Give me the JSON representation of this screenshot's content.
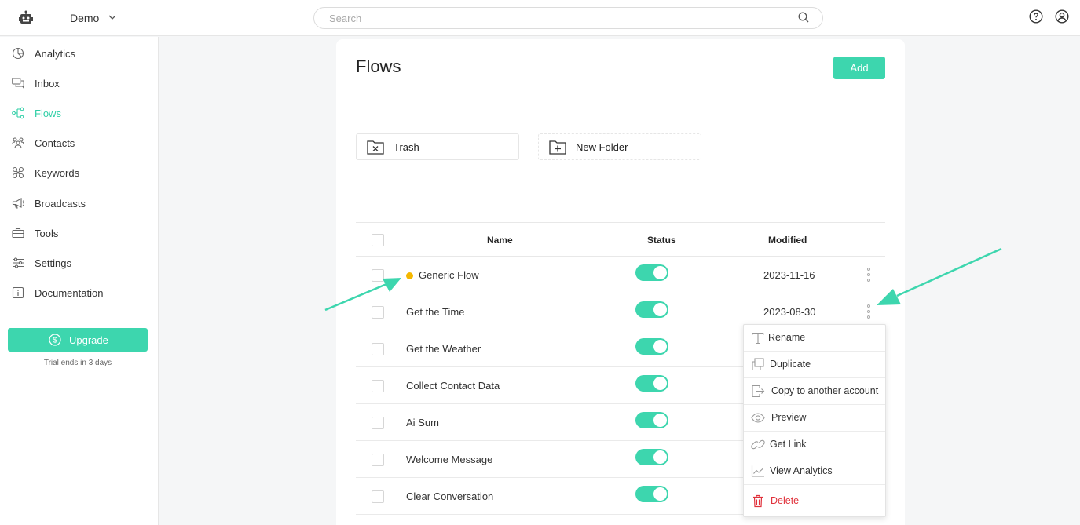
{
  "header": {
    "account_name": "Demo",
    "search_placeholder": "Search",
    "icons": [
      "robot-logo-icon",
      "chevron-down-icon",
      "search-icon",
      "help-icon",
      "user-icon"
    ]
  },
  "sidebar": {
    "items": [
      {
        "label": "Analytics",
        "icon": "pie-chart-icon",
        "active": false
      },
      {
        "label": "Inbox",
        "icon": "chat-bubbles-icon",
        "active": false
      },
      {
        "label": "Flows",
        "icon": "flows-icon",
        "active": true
      },
      {
        "label": "Contacts",
        "icon": "contacts-icon",
        "active": false
      },
      {
        "label": "Keywords",
        "icon": "keywords-icon",
        "active": false
      },
      {
        "label": "Broadcasts",
        "icon": "megaphone-icon",
        "active": false
      },
      {
        "label": "Tools",
        "icon": "toolbox-icon",
        "active": false
      },
      {
        "label": "Settings",
        "icon": "sliders-icon",
        "active": false
      },
      {
        "label": "Documentation",
        "icon": "info-icon",
        "active": false
      }
    ],
    "upgrade_label": "Upgrade",
    "trial_text": "Trial ends in 3 days"
  },
  "main": {
    "title": "Flows",
    "add_label": "Add",
    "folders": [
      {
        "label": "Trash",
        "icon": "trash-folder-icon"
      },
      {
        "label": "New Folder",
        "icon": "new-folder-icon"
      }
    ],
    "table": {
      "columns": [
        "Name",
        "Status",
        "Modified"
      ],
      "rows": [
        {
          "name": "Generic Flow",
          "status": true,
          "modified": "2023-11-16",
          "draft_dot": true
        },
        {
          "name": "Get the Time",
          "status": true,
          "modified": "2023-08-30",
          "draft_dot": false
        },
        {
          "name": "Get the Weather",
          "status": true,
          "modified": "",
          "draft_dot": false
        },
        {
          "name": "Collect Contact Data",
          "status": true,
          "modified": "",
          "draft_dot": false
        },
        {
          "name": "Ai Sum",
          "status": true,
          "modified": "",
          "draft_dot": false
        },
        {
          "name": "Welcome Message",
          "status": true,
          "modified": "",
          "draft_dot": false
        },
        {
          "name": "Clear Conversation",
          "status": true,
          "modified": "",
          "draft_dot": false
        }
      ]
    }
  },
  "context_menu": {
    "items": [
      {
        "label": "Rename",
        "icon": "text-icon"
      },
      {
        "label": "Duplicate",
        "icon": "duplicate-icon"
      },
      {
        "label": "Copy to another account",
        "icon": "export-icon"
      },
      {
        "label": "Preview",
        "icon": "eye-icon"
      },
      {
        "label": "Get Link",
        "icon": "link-icon"
      },
      {
        "label": "View Analytics",
        "icon": "line-chart-icon"
      },
      {
        "label": "Delete",
        "icon": "delete-icon"
      }
    ]
  },
  "colors": {
    "accent": "#3dd6ae",
    "accent_text": "#2fcfa6",
    "draft_dot": "#f5b800",
    "danger": "#e0313b"
  }
}
